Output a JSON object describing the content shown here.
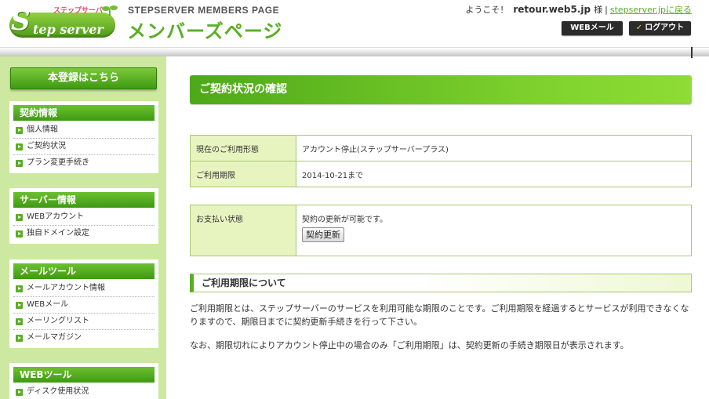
{
  "header": {
    "logo_kana": "ステップサーバー",
    "logo_word": "tep server",
    "logo_s": "S",
    "members_en": "STEPSERVER MEMBERS PAGE",
    "members_ja": "メンバーズページ",
    "welcome_label": "ようこそ！",
    "username": "retour.web5.jp",
    "honorific": "様",
    "separator": "|",
    "back_link": "stepserver.jpに戻る",
    "webmail_button": "WEBメール",
    "logout_button": "ログアウト",
    "logout_check": "✓"
  },
  "sidebar": {
    "register_button": "本登録はこちら",
    "sections": [
      {
        "title": "契約情報",
        "items": [
          "個人情報",
          "ご契約状況",
          "プラン変更手続き"
        ]
      },
      {
        "title": "サーバー情報",
        "items": [
          "WEBアカウント",
          "独自ドメイン設定"
        ]
      },
      {
        "title": "メールツール",
        "items": [
          "メールアカウント情報",
          "WEBメール",
          "メーリングリスト",
          "メールマガジン"
        ]
      },
      {
        "title": "WEBツール",
        "items": [
          "ディスク使用状況"
        ]
      }
    ]
  },
  "main": {
    "title": "ご契約状況の確認",
    "table1": [
      {
        "label": "現在のご利用形態",
        "value": "アカウント停止(ステップサーバープラス)"
      },
      {
        "label": "ご利用期限",
        "value": "2014-10-21まで"
      }
    ],
    "payment": {
      "label": "お支払い状態",
      "text": "契約の更新が可能です。",
      "button": "契約更新"
    },
    "section_heading": "ご利用期限について",
    "paragraph1": "ご利用期限とは、ステップサーバーのサービスを利用可能な期限のことです。ご利用期限を経過するとサービスが利用できなくなりますので、期限日までに契約更新手続きを行って下さい。",
    "paragraph2": "なお、期限切れによりアカウント停止中の場合のみ「ご利用期限」は、契約更新の手続き期限日が表示されます。"
  },
  "colors": {
    "brand_green": "#5aae25",
    "sidebar_bg": "#cde8a0",
    "label_bg": "#e7f4bf",
    "logo_accent": "#e0427a"
  }
}
